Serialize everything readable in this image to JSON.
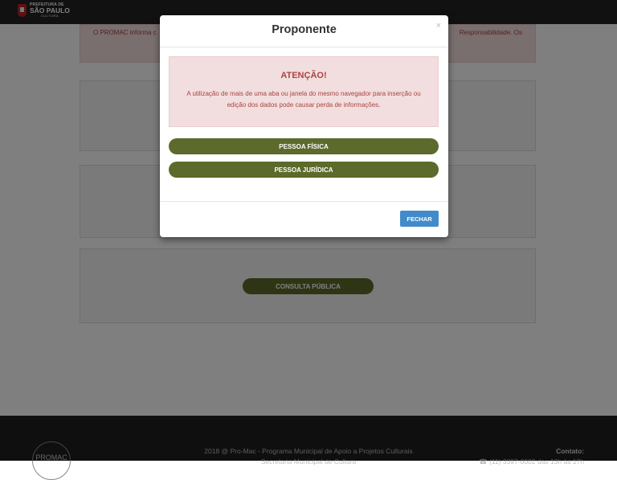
{
  "header": {
    "logo_line1": "PREFEITURA DE",
    "logo_line2": "SÃO PAULO",
    "logo_line3": "CULTURA"
  },
  "page": {
    "alert_left": "O PROMAC informa c",
    "alert_right": "Responsabilidade. Os",
    "consulta_button": "CONSULTA PÚBLICA"
  },
  "footer": {
    "logo_text": "PROMAC",
    "line1": "2018 @ Pro-Mac - Programa Municipal de Apoio a Projetos Culturais",
    "line2": "Secretaria Municipal de Cultura",
    "contact_title": "Contato:",
    "contact_phone": "(11) 3397-0002 das 13h às 17h"
  },
  "modal": {
    "title": "Proponente",
    "close": "×",
    "warning_title": "ATENÇÃO!",
    "warning_text": "A utilização de mais de uma aba ou janela do mesmo navegador para inserção ou edição dos dados pode causar perda de informações.",
    "btn_pessoa_fisica": "PESSOA FÍSICA",
    "btn_pessoa_juridica": "PESSOA JURÍDICA",
    "btn_fechar": "FECHAR"
  },
  "colors": {
    "olive_button": "#5c6a2b",
    "primary_blue": "#428bca",
    "alert_bg": "#f2dede",
    "alert_text": "#a94442"
  }
}
